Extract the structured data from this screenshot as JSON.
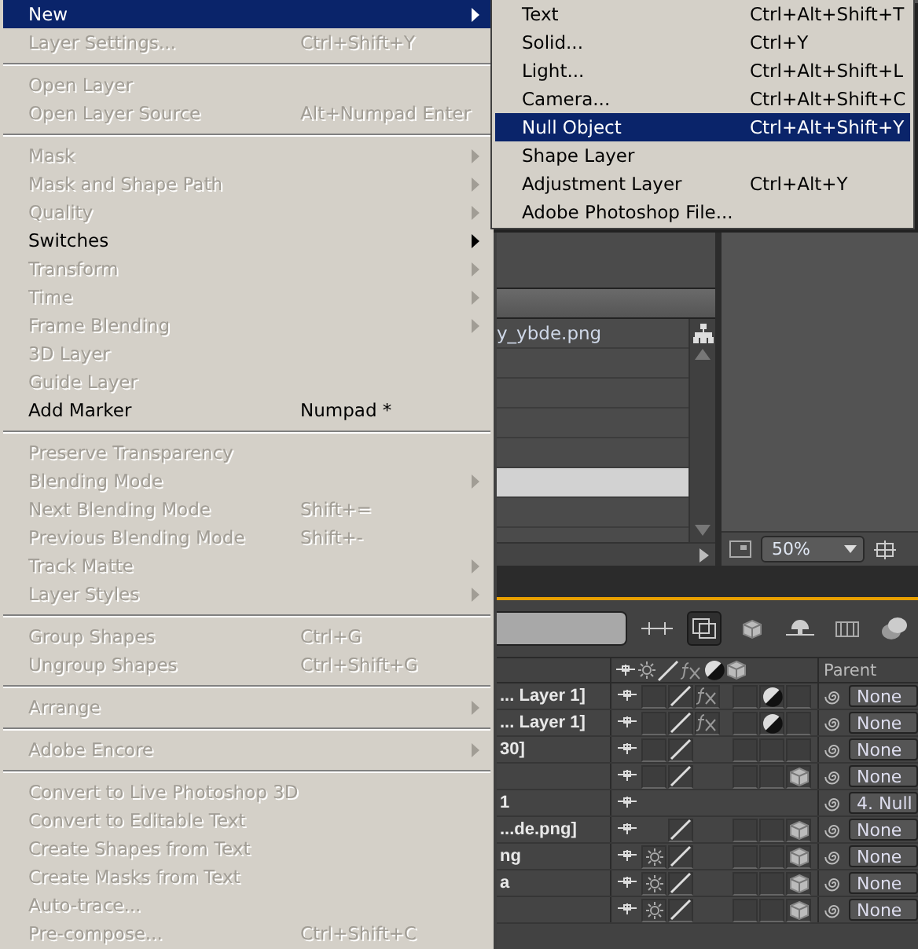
{
  "menu": {
    "items": [
      {
        "kind": "item",
        "label": "New",
        "submenu": true,
        "disabled": false,
        "selected": true
      },
      {
        "kind": "item",
        "label": "Layer Settings...",
        "shortcut": "Ctrl+Shift+Y",
        "submenu": false,
        "disabled": true,
        "selected": false
      },
      {
        "kind": "separator"
      },
      {
        "kind": "item",
        "label": "Open Layer",
        "submenu": false,
        "disabled": true,
        "selected": false
      },
      {
        "kind": "item",
        "label": "Open Layer Source",
        "shortcut": "Alt+Numpad Enter",
        "submenu": false,
        "disabled": true,
        "selected": false
      },
      {
        "kind": "separator"
      },
      {
        "kind": "item",
        "label": "Mask",
        "submenu": true,
        "disabled": true,
        "selected": false
      },
      {
        "kind": "item",
        "label": "Mask and Shape Path",
        "submenu": true,
        "disabled": true,
        "selected": false
      },
      {
        "kind": "item",
        "label": "Quality",
        "submenu": true,
        "disabled": true,
        "selected": false
      },
      {
        "kind": "item",
        "label": "Switches",
        "submenu": true,
        "disabled": false,
        "selected": false
      },
      {
        "kind": "item",
        "label": "Transform",
        "submenu": true,
        "disabled": true,
        "selected": false
      },
      {
        "kind": "item",
        "label": "Time",
        "submenu": true,
        "disabled": true,
        "selected": false
      },
      {
        "kind": "item",
        "label": "Frame Blending",
        "submenu": true,
        "disabled": true,
        "selected": false
      },
      {
        "kind": "item",
        "label": "3D Layer",
        "submenu": false,
        "disabled": true,
        "selected": false
      },
      {
        "kind": "item",
        "label": "Guide Layer",
        "submenu": false,
        "disabled": true,
        "selected": false
      },
      {
        "kind": "item",
        "label": "Add Marker",
        "shortcut": "Numpad *",
        "submenu": false,
        "disabled": false,
        "selected": false
      },
      {
        "kind": "separator"
      },
      {
        "kind": "item",
        "label": "Preserve Transparency",
        "submenu": false,
        "disabled": true,
        "selected": false
      },
      {
        "kind": "item",
        "label": "Blending Mode",
        "submenu": true,
        "disabled": true,
        "selected": false
      },
      {
        "kind": "item",
        "label": "Next Blending Mode",
        "shortcut": "Shift+=",
        "submenu": false,
        "disabled": true,
        "selected": false
      },
      {
        "kind": "item",
        "label": "Previous Blending Mode",
        "shortcut": "Shift+-",
        "submenu": false,
        "disabled": true,
        "selected": false
      },
      {
        "kind": "item",
        "label": "Track Matte",
        "submenu": true,
        "disabled": true,
        "selected": false
      },
      {
        "kind": "item",
        "label": "Layer Styles",
        "submenu": true,
        "disabled": true,
        "selected": false
      },
      {
        "kind": "separator"
      },
      {
        "kind": "item",
        "label": "Group Shapes",
        "shortcut": "Ctrl+G",
        "submenu": false,
        "disabled": true,
        "selected": false
      },
      {
        "kind": "item",
        "label": "Ungroup Shapes",
        "shortcut": "Ctrl+Shift+G",
        "submenu": false,
        "disabled": true,
        "selected": false
      },
      {
        "kind": "separator"
      },
      {
        "kind": "item",
        "label": "Arrange",
        "submenu": true,
        "disabled": true,
        "selected": false
      },
      {
        "kind": "separator"
      },
      {
        "kind": "item",
        "label": "Adobe Encore",
        "submenu": true,
        "disabled": true,
        "selected": false
      },
      {
        "kind": "separator"
      },
      {
        "kind": "item",
        "label": "Convert to Live Photoshop 3D",
        "submenu": false,
        "disabled": true,
        "selected": false
      },
      {
        "kind": "item",
        "label": "Convert to Editable Text",
        "submenu": false,
        "disabled": true,
        "selected": false
      },
      {
        "kind": "item",
        "label": "Create Shapes from Text",
        "submenu": false,
        "disabled": true,
        "selected": false
      },
      {
        "kind": "item",
        "label": "Create Masks from Text",
        "submenu": false,
        "disabled": true,
        "selected": false
      },
      {
        "kind": "item",
        "label": "Auto-trace...",
        "submenu": false,
        "disabled": true,
        "selected": false
      },
      {
        "kind": "item",
        "label": "Pre-compose...",
        "shortcut": "Ctrl+Shift+C",
        "submenu": false,
        "disabled": true,
        "selected": false
      }
    ]
  },
  "submenu": {
    "items": [
      {
        "label": "Text",
        "shortcut": "Ctrl+Alt+Shift+T",
        "selected": false
      },
      {
        "label": "Solid...",
        "shortcut": "Ctrl+Y",
        "selected": false
      },
      {
        "label": "Light...",
        "shortcut": "Ctrl+Alt+Shift+L",
        "selected": false
      },
      {
        "label": "Camera...",
        "shortcut": "Ctrl+Alt+Shift+C",
        "selected": false
      },
      {
        "label": "Null Object",
        "shortcut": "Ctrl+Alt+Shift+Y",
        "selected": true
      },
      {
        "label": "Shape Layer",
        "selected": false
      },
      {
        "label": "Adjustment Layer",
        "shortcut": "Ctrl+Alt+Y",
        "selected": false
      },
      {
        "label": "Adobe Photoshop File...",
        "selected": false
      }
    ]
  },
  "project": {
    "rows": [
      {
        "name": "y_ybde.png",
        "selected": false
      },
      {
        "selected": false
      },
      {
        "selected": false
      },
      {
        "selected": false
      },
      {
        "selected": false
      },
      {
        "selected": true
      },
      {
        "selected": false
      }
    ]
  },
  "viewer": {
    "zoom": "50%"
  },
  "timeline": {
    "parent_heading": "Parent",
    "rows": [
      {
        "kind": "layer",
        "name": "... Layer 1]",
        "sun": false,
        "box2": true,
        "fx": true,
        "adjust": true,
        "three_d": false,
        "parent": "None"
      },
      {
        "kind": "layer",
        "name": "... Layer 1]",
        "sun": false,
        "box2": true,
        "fx": true,
        "adjust": true,
        "three_d": false,
        "parent": "None"
      },
      {
        "kind": "layer",
        "name": "30]",
        "sun": false,
        "box2": true,
        "fx": false,
        "adjust": false,
        "three_d": false,
        "parent": "None"
      },
      {
        "kind": "layer",
        "sun": false,
        "box2": true,
        "fx": false,
        "adjust": false,
        "three_d": true,
        "parent": "None"
      },
      {
        "kind": "null",
        "name": "1",
        "parent": "4. Null"
      },
      {
        "kind": "layer",
        "name": "...de.png]",
        "sun": false,
        "box2": false,
        "fx": false,
        "adjust": false,
        "three_d": true,
        "parent": "None"
      },
      {
        "kind": "layer",
        "name": "ng",
        "sun": true,
        "box2": true,
        "fx": false,
        "adjust": false,
        "three_d": true,
        "parent": "None"
      },
      {
        "kind": "layer",
        "name": "a",
        "sun": true,
        "box2": true,
        "fx": false,
        "adjust": false,
        "three_d": true,
        "parent": "None"
      },
      {
        "kind": "layer",
        "sun": true,
        "box2": true,
        "fx": false,
        "adjust": false,
        "three_d": true,
        "parent": "None"
      }
    ]
  }
}
